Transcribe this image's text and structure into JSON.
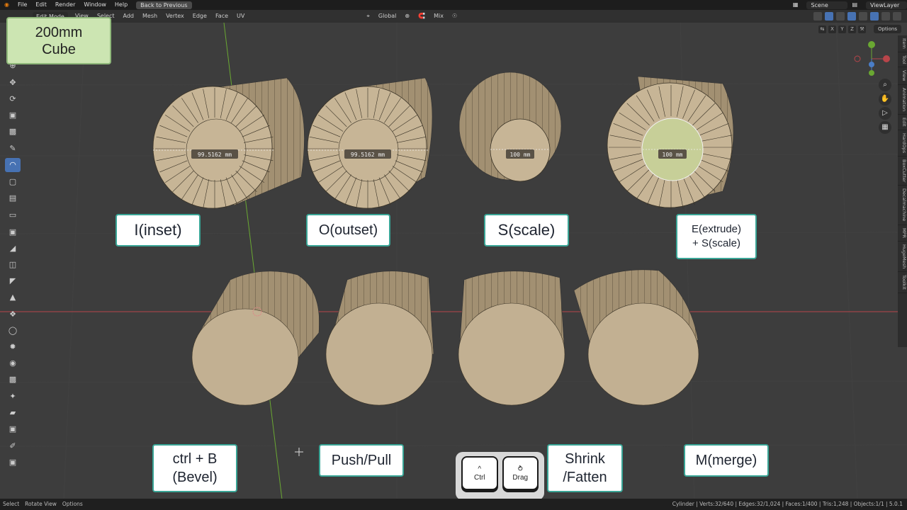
{
  "topbar": {
    "menus": [
      "File",
      "Edit",
      "Render",
      "Window",
      "Help"
    ],
    "back_label": "Back to Previous",
    "scene": "Scene",
    "view_layer": "ViewLayer"
  },
  "header": {
    "mode": "Edit Mode",
    "menus": [
      "View",
      "Select",
      "Add",
      "Mesh",
      "Vertex",
      "Edge",
      "Face",
      "UV"
    ],
    "orientation": "Global",
    "snap_mode": "Mix",
    "axes": [
      "X",
      "Y",
      "Z"
    ],
    "options_label": "Options"
  },
  "side_tabs": [
    "Item",
    "Tool",
    "View",
    "Animation",
    "Edit",
    "HardOps",
    "BoxCutter",
    "Decalmachine",
    "MPR",
    "HugeMesh",
    "Toolkit"
  ],
  "overlay": {
    "cube_label": "200mm\nCube",
    "labels": [
      {
        "id": "inset",
        "text": "I(inset)"
      },
      {
        "id": "outset",
        "text": "O(outset)"
      },
      {
        "id": "scale",
        "text": "S(scale)"
      },
      {
        "id": "extrude",
        "text": "E(extrude)\n+ S(scale)"
      },
      {
        "id": "bevel",
        "text": "ctrl + B\n(Bevel)"
      },
      {
        "id": "pushpull",
        "text": "Push/Pull"
      },
      {
        "id": "shrink",
        "text": "Shrink\n/Fatten"
      },
      {
        "id": "merge",
        "text": "M(merge)"
      }
    ],
    "keys": [
      {
        "symbol": "^",
        "label": "Ctrl"
      },
      {
        "symbol": "⥁",
        "label": "Drag"
      }
    ],
    "measurements": [
      "99.5162 mm",
      "99.5162 mm",
      "100 mm",
      "100 mm"
    ]
  },
  "status": {
    "left": [
      "Select",
      "Rotate View",
      "Options"
    ],
    "right": "Cylinder | Verts:32/640 | Edges:32/1,024 | Faces:1/400 | Tris:1,248 | Objects:1/1 | 5.0.1"
  },
  "colors": {
    "viewport_bg": "#3d3d3d",
    "cylinder_face": "#c7b596",
    "cylinder_side": "#9d8c6d",
    "label_border": "#39a596",
    "cube_label_bg": "#cce5b2",
    "active_tool": "#4772b3",
    "y_axis_line": "#6aa832",
    "x_axis_line": "#b8454a"
  }
}
